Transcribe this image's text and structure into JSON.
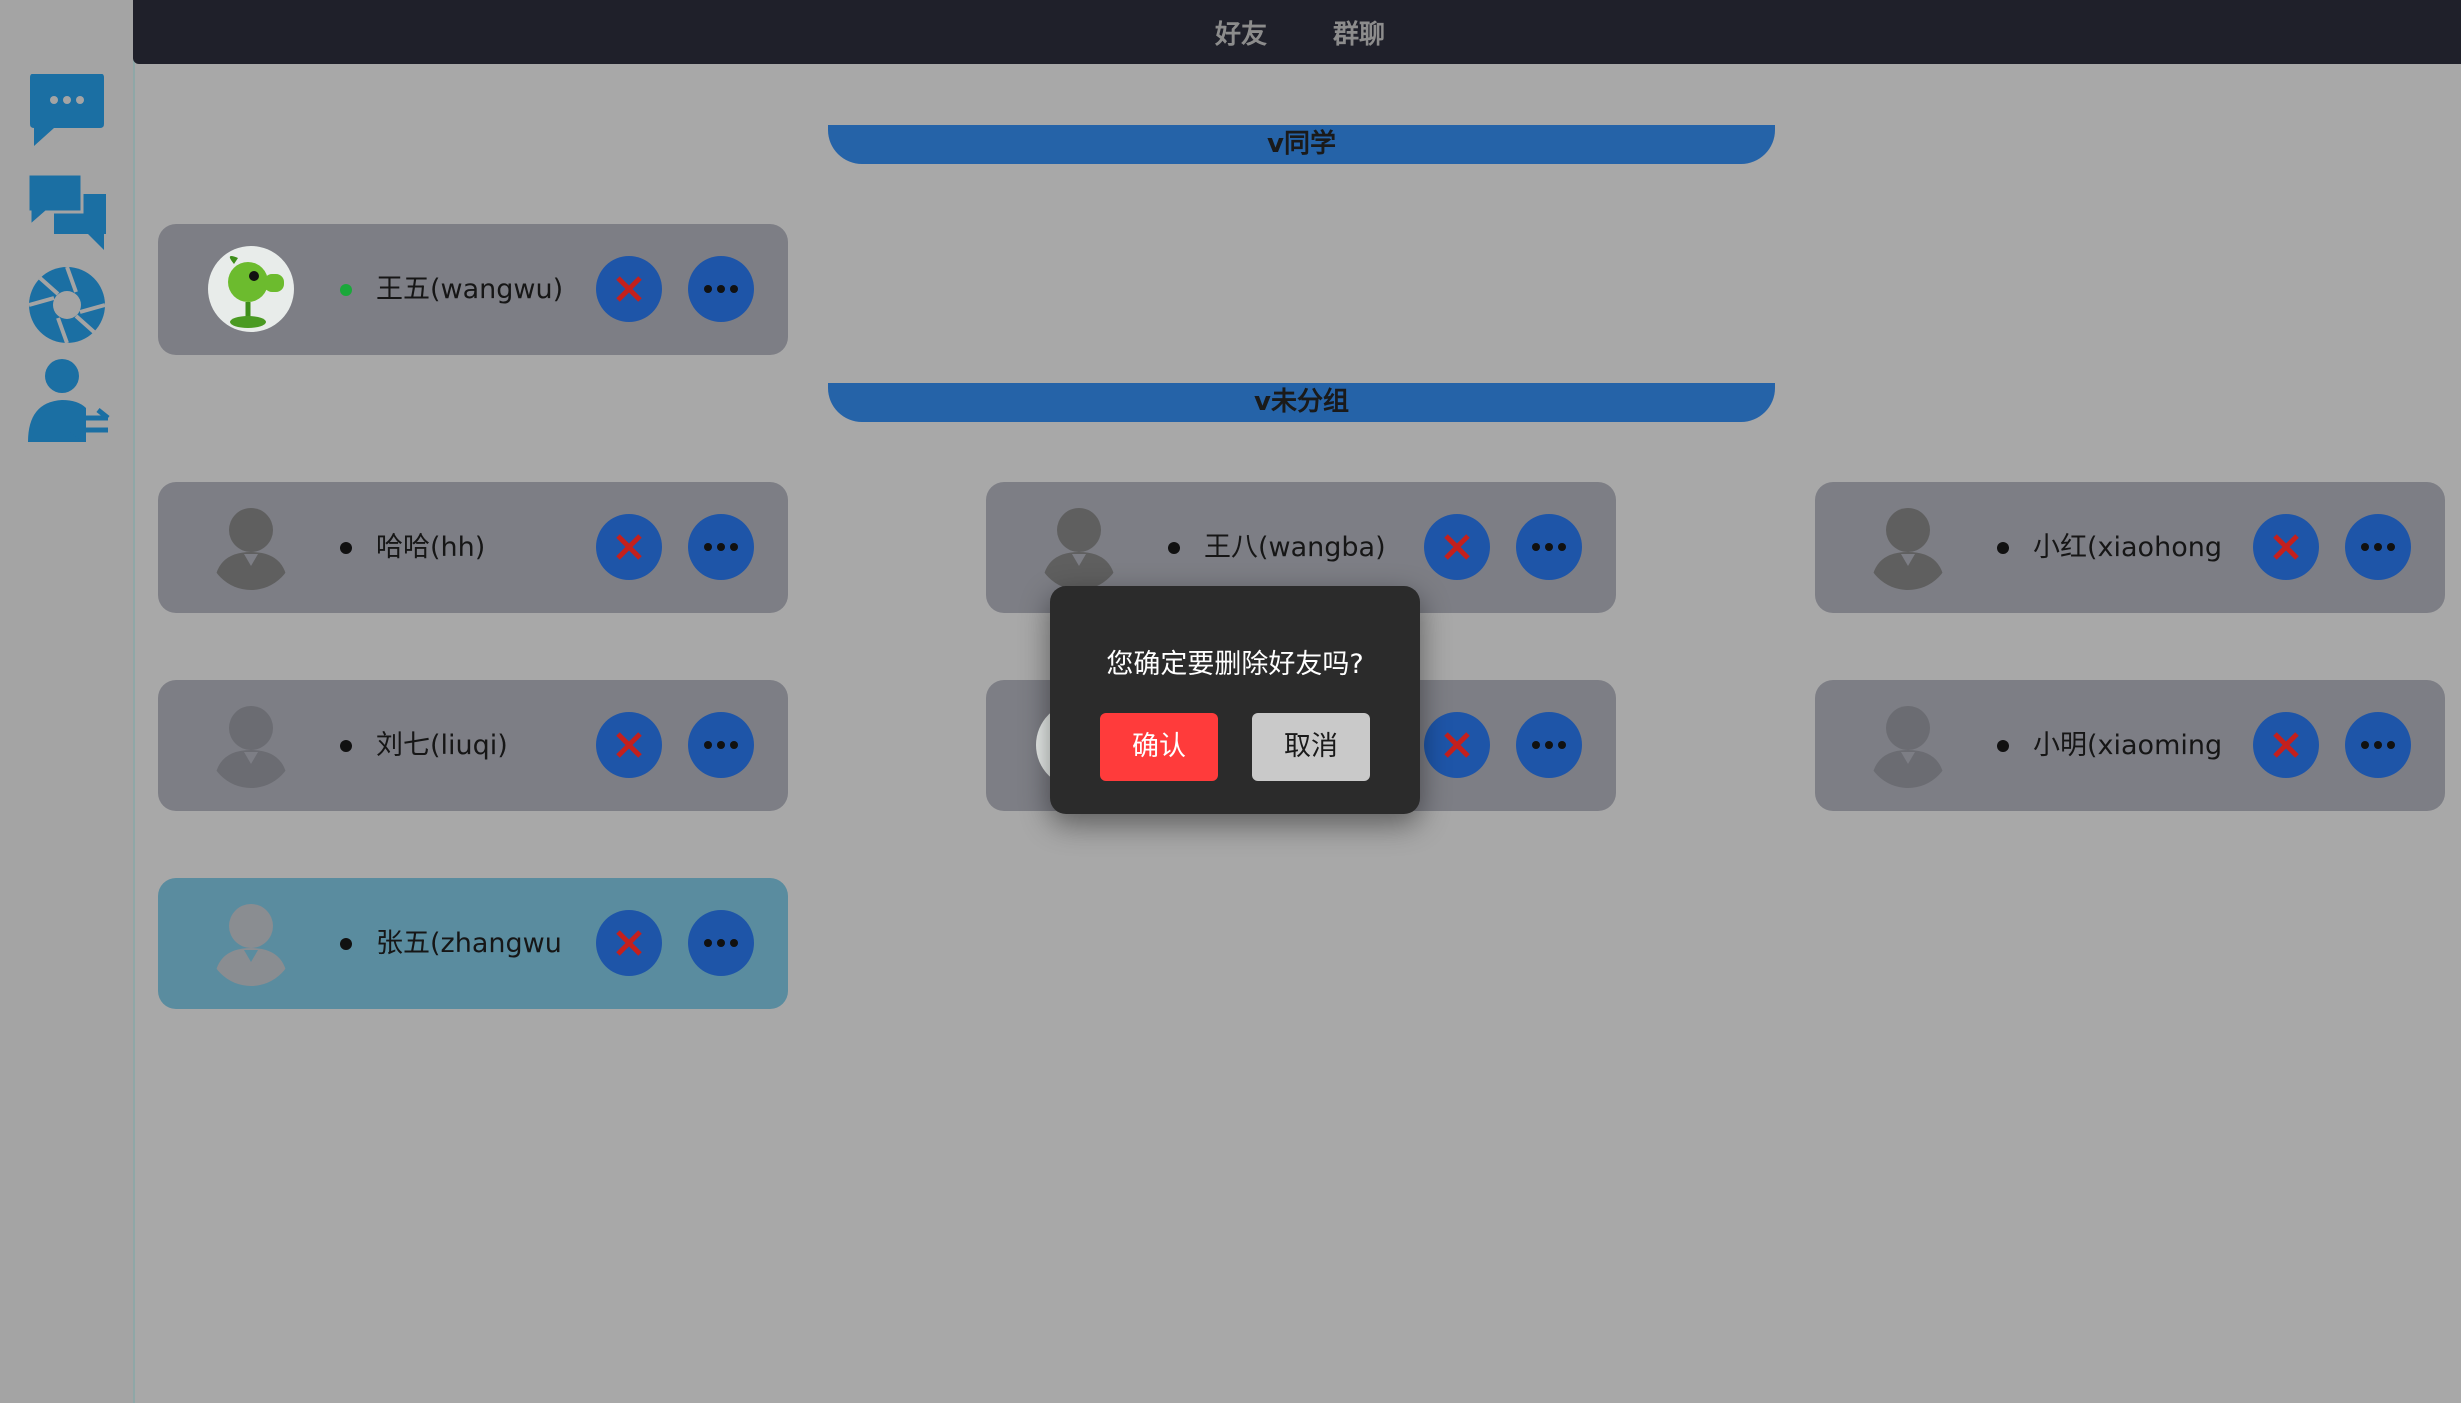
{
  "tabs": {
    "friends": "好友",
    "groups": "群聊"
  },
  "sidebar": {
    "items": [
      {
        "icon": "chat-bubble-icon"
      },
      {
        "icon": "conversations-icon"
      },
      {
        "icon": "aperture-icon"
      },
      {
        "icon": "user-transfer-icon"
      }
    ]
  },
  "groups": [
    {
      "label": "v同学"
    },
    {
      "label": "v未分组"
    }
  ],
  "friends": [
    {
      "name": "王五(wangwu)",
      "online": true,
      "avatar": "peashooter-avatar"
    },
    {
      "name": "哈哈(hh)",
      "online": false,
      "avatar": "default-avatar"
    },
    {
      "name": "王八(wangba)",
      "online": false,
      "avatar": "default-avatar"
    },
    {
      "name": "小红(xiaohong",
      "online": false,
      "avatar": "default-avatar"
    },
    {
      "name": "刘七(liuqi)",
      "online": false,
      "avatar": "default-avatar"
    },
    {
      "name": "",
      "online": false,
      "avatar": "peashooter-avatar"
    },
    {
      "name": "小明(xiaoming",
      "online": false,
      "avatar": "default-avatar"
    },
    {
      "name": "张五(zhangwu",
      "online": false,
      "avatar": "default-avatar",
      "selected": true
    }
  ],
  "modal": {
    "message": "您确定要删除好友吗?",
    "confirm": "确认",
    "cancel": "取消"
  },
  "colors": {
    "accent": "#2563a8",
    "danger": "#ff3b3b",
    "online": "#1aa83a"
  }
}
